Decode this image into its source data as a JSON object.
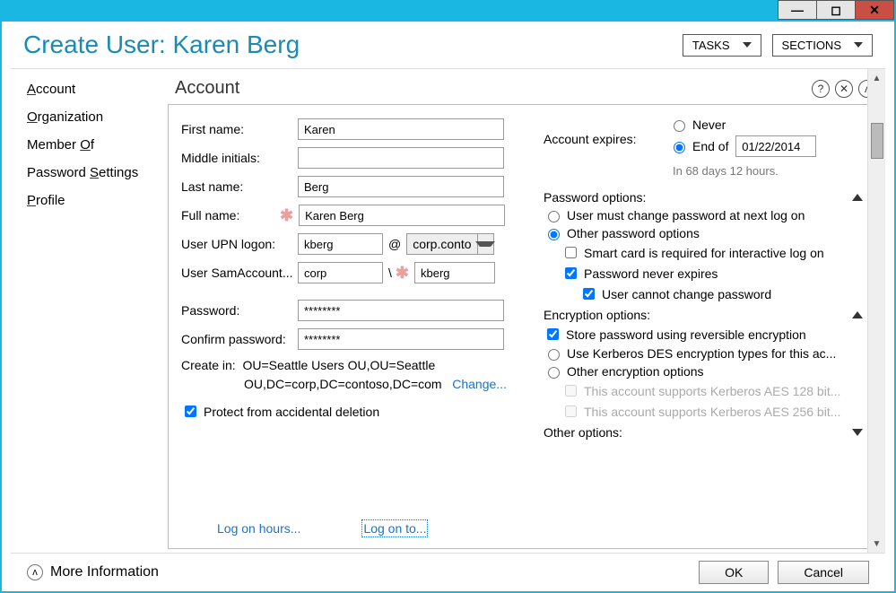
{
  "window": {
    "title": "Create User: Karen Berg",
    "tasks_btn": "TASKS",
    "sections_btn": "SECTIONS"
  },
  "sidebar": {
    "items": [
      {
        "label": "Account",
        "accel": "A"
      },
      {
        "label": "Organization",
        "accel": "O"
      },
      {
        "label": "Member Of",
        "accel": "O"
      },
      {
        "label": "Password Settings",
        "accel": "S"
      },
      {
        "label": "Profile",
        "accel": "P"
      }
    ]
  },
  "section": {
    "heading": "Account"
  },
  "fields": {
    "first_name_label": "First name:",
    "first_name": "Karen",
    "middle_label": "Middle initials:",
    "middle": "",
    "last_name_label": "Last name:",
    "last_name": "Berg",
    "full_name_label": "Full name:",
    "full_name": "Karen Berg",
    "upn_label": "User UPN logon:",
    "upn_user": "kberg",
    "upn_domain": "corp.conto",
    "sam_label": "User SamAccount...",
    "sam_domain": "corp",
    "sam_user": "kberg",
    "password_label": "Password:",
    "password": "********",
    "confirm_label": "Confirm password:",
    "confirm": "********",
    "createin_label": "Create in:",
    "createin_path1": "OU=Seattle Users OU,OU=Seattle",
    "createin_path2": "OU,DC=corp,DC=contoso,DC=com",
    "change_link": "Change...",
    "protect_label": "Protect from accidental deletion"
  },
  "expires": {
    "label": "Account expires:",
    "never": "Never",
    "endof": "End of",
    "date": "01/22/2014",
    "hint": "In 68 days 12 hours."
  },
  "pwdopts": {
    "heading": "Password options:",
    "must_change": "User must change password at next log on",
    "other": "Other password options",
    "smartcard": "Smart card is required for interactive log on",
    "never_expires": "Password never expires",
    "cannot_change": "User cannot change password"
  },
  "encopts": {
    "heading": "Encryption options:",
    "reversible": "Store password using reversible encryption",
    "kerberos_des": "Use Kerberos DES encryption types for this ac...",
    "other": "Other encryption options",
    "aes128": "This account supports Kerberos AES 128 bit...",
    "aes256": "This account supports Kerberos AES 256 bit..."
  },
  "otheropts": {
    "heading": "Other options:"
  },
  "links": {
    "logon_hours": "Log on hours...",
    "logon_to": "Log on to..."
  },
  "footer": {
    "more_info": "More Information",
    "ok": "OK",
    "cancel": "Cancel"
  }
}
